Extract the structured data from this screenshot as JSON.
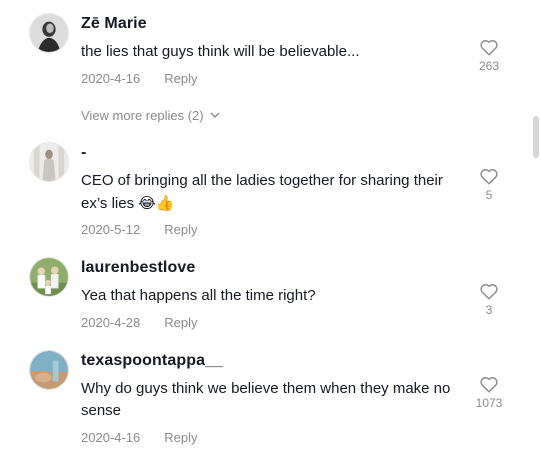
{
  "comments": [
    {
      "username": "Zē Marie",
      "text": "the lies that guys think will be believable...",
      "date": "2020-4-16",
      "reply_label": "Reply",
      "likes": "263",
      "avatar_icon": "profile-photo"
    },
    {
      "username": "-",
      "text": "CEO of bringing all the ladies together for sharing their ex’s lies",
      "emoji": "😂👍",
      "date": "2020-5-12",
      "reply_label": "Reply",
      "likes": "5",
      "avatar_icon": "profile-photo"
    },
    {
      "username": "laurenbestlove",
      "text": "Yea that happens all the time right?",
      "date": "2020-4-28",
      "reply_label": "Reply",
      "likes": "3",
      "avatar_icon": "profile-photo"
    },
    {
      "username": "texaspoontappa__",
      "text": "Why do guys think we believe them when they make no sense",
      "date": "2020-4-16",
      "reply_label": "Reply",
      "likes": "1073",
      "avatar_icon": "profile-photo"
    }
  ],
  "view_more": {
    "label": "View more replies (2)"
  },
  "icons": {
    "like": "heart-outline-icon",
    "expand": "chevron-down-icon"
  },
  "colors": {
    "text": "#161823",
    "muted": "#8a8b91",
    "icon": "#8a8b91"
  }
}
